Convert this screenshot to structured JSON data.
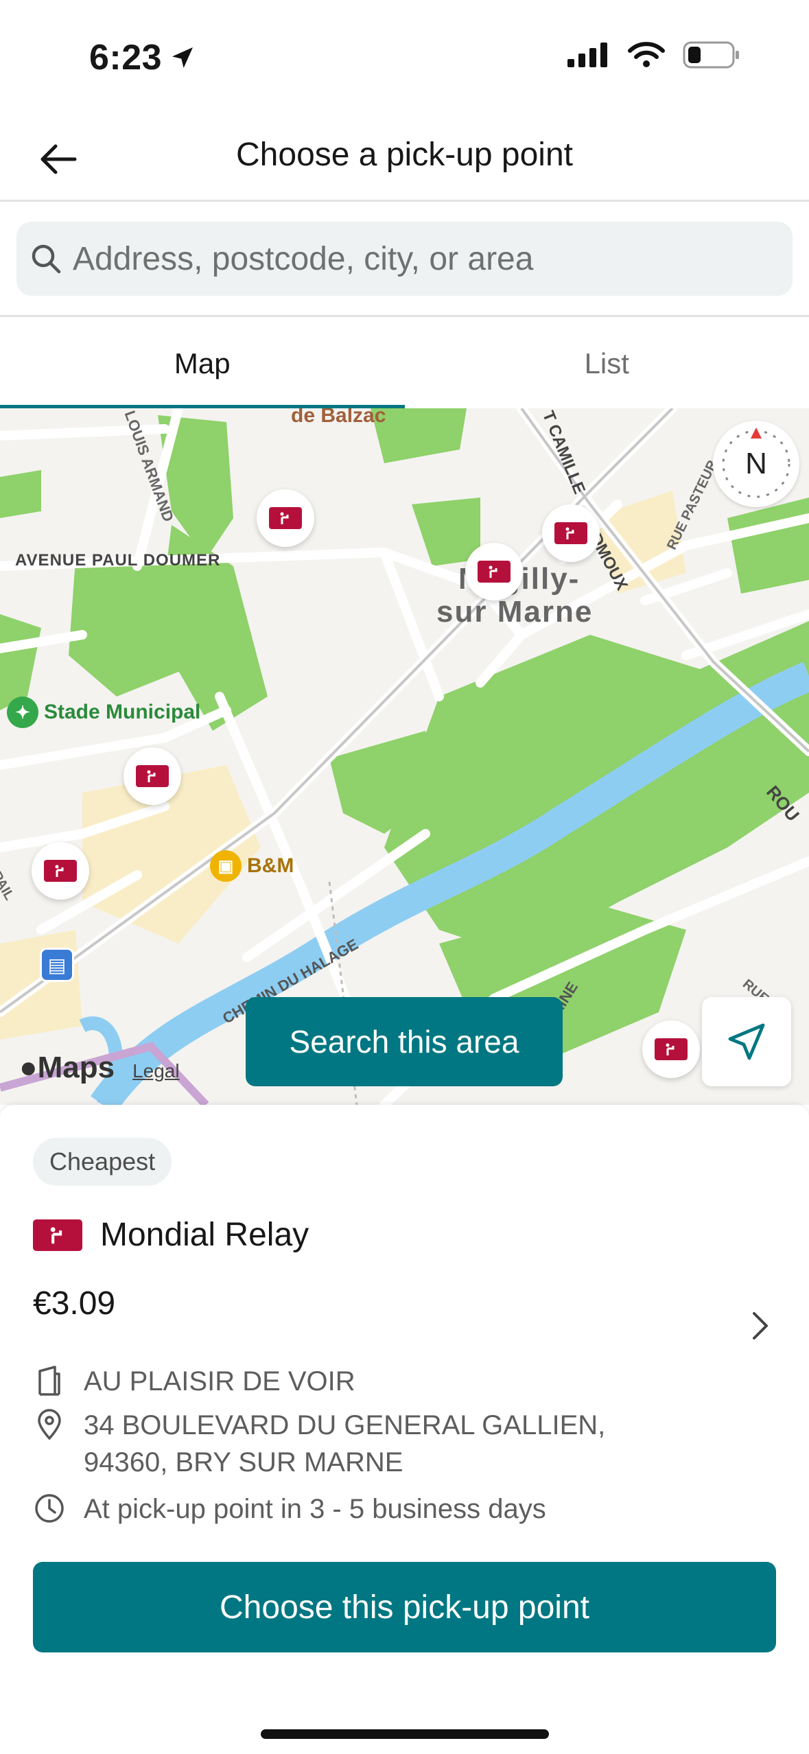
{
  "status_bar": {
    "time": "6:23"
  },
  "header": {
    "title": "Choose a pick-up point"
  },
  "search": {
    "placeholder": "Address, postcode, city, or area"
  },
  "tabs": [
    {
      "label": "Map",
      "active": true
    },
    {
      "label": "List",
      "active": false
    }
  ],
  "map": {
    "labels": {
      "balzac": "de Balzac",
      "louis_armand": "LOUIS ARMAND",
      "camille": "T CAMILLE",
      "desmoulins": "DMOUX",
      "rue_pasteur": "RUE PASTEUR",
      "avenue": "AVENUE PAUL DOUMER",
      "town": "Nogilly-",
      "town2": "sur Marne",
      "stade": "Stade Municipal",
      "bm": "B&M",
      "spail": "SPAIL",
      "chemin": "CHEMIN DU HALAGE",
      "aine": "AINE",
      "rue_right": "RUE",
      "rou": "ROU"
    },
    "compass_label": "N",
    "search_area_label": "Search this area",
    "attribution": {
      "logo": "Maps",
      "legal": "Legal"
    },
    "colors": {
      "park": "#8fd16a",
      "water": "#8ecdf2",
      "road": "#ffffff",
      "block": "#f4f3f0",
      "sand": "#f9edc8"
    }
  },
  "sheet": {
    "badge": "Cheapest",
    "carrier": "Mondial Relay",
    "price": "€3.09",
    "location_name": "AU PLAISIR DE VOIR",
    "address_line1": "34 BOULEVARD DU GENERAL GALLIEN,",
    "address_line2": "94360, BRY SUR MARNE",
    "delivery": "At pick-up point in 3 - 5 business days",
    "cta": "Choose this pick-up point"
  },
  "colors": {
    "brand": "#007782",
    "carrier": "#b5103c"
  }
}
